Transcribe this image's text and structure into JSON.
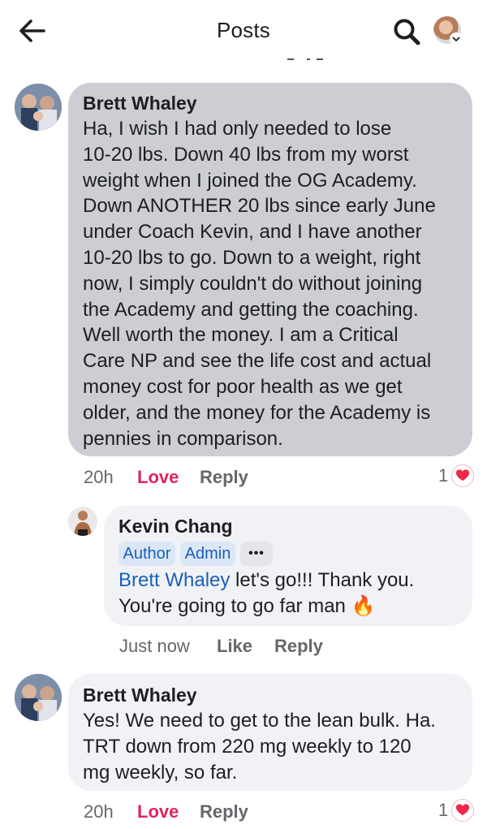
{
  "header": {
    "title": "Posts",
    "back_icon": "arrow-left-icon",
    "search_icon": "search-icon",
    "profile_icon": "profile-avatar",
    "chevron_icon": "chevron-down-icon"
  },
  "comments": [
    {
      "author": "Brett Whaley",
      "text_lines": [
        "Ha, I wish I had only needed to lose",
        "10-20 lbs. Down 40 lbs from my worst",
        "weight when I joined the OG Academy.",
        "Down ANOTHER 20 lbs since early June",
        "under Coach Kevin, and I have another",
        "10-20 lbs to go. Down to a weight, right",
        "now, I simply couldn't do without joining",
        "the Academy and getting the coaching.",
        "Well worth the money. I am a Critical",
        "Care NP and see the life cost and actual",
        "money cost for poor health as we get",
        "older, and the money for the Academy is",
        "pennies in comparison."
      ],
      "time": "20h",
      "reaction_label": "Love",
      "reply_label": "Reply",
      "reaction_count": "1"
    },
    {
      "author": "Kevin Chang",
      "badges": [
        "Author",
        "Admin"
      ],
      "more_label": "•••",
      "mention": "Brett Whaley",
      "text_line1_rest": " let's go!!! Thank you.",
      "text_line2": "You're going to go far man",
      "emoji": "🔥",
      "time": "Just now",
      "like_label": "Like",
      "reply_label": "Reply"
    },
    {
      "author": "Brett Whaley",
      "text_lines": [
        "Yes! We need to get to the lean bulk. Ha.",
        "TRT down from 220 mg weekly to 120",
        "mg weekly, so far."
      ],
      "time": "20h",
      "reaction_label": "Love",
      "reply_label": "Reply",
      "reaction_count": "1"
    }
  ],
  "colors": {
    "love": "#e0245e",
    "link": "#1b5fb8",
    "bubble_highlight": "#ccced3",
    "bubble": "#f0f2f5"
  }
}
